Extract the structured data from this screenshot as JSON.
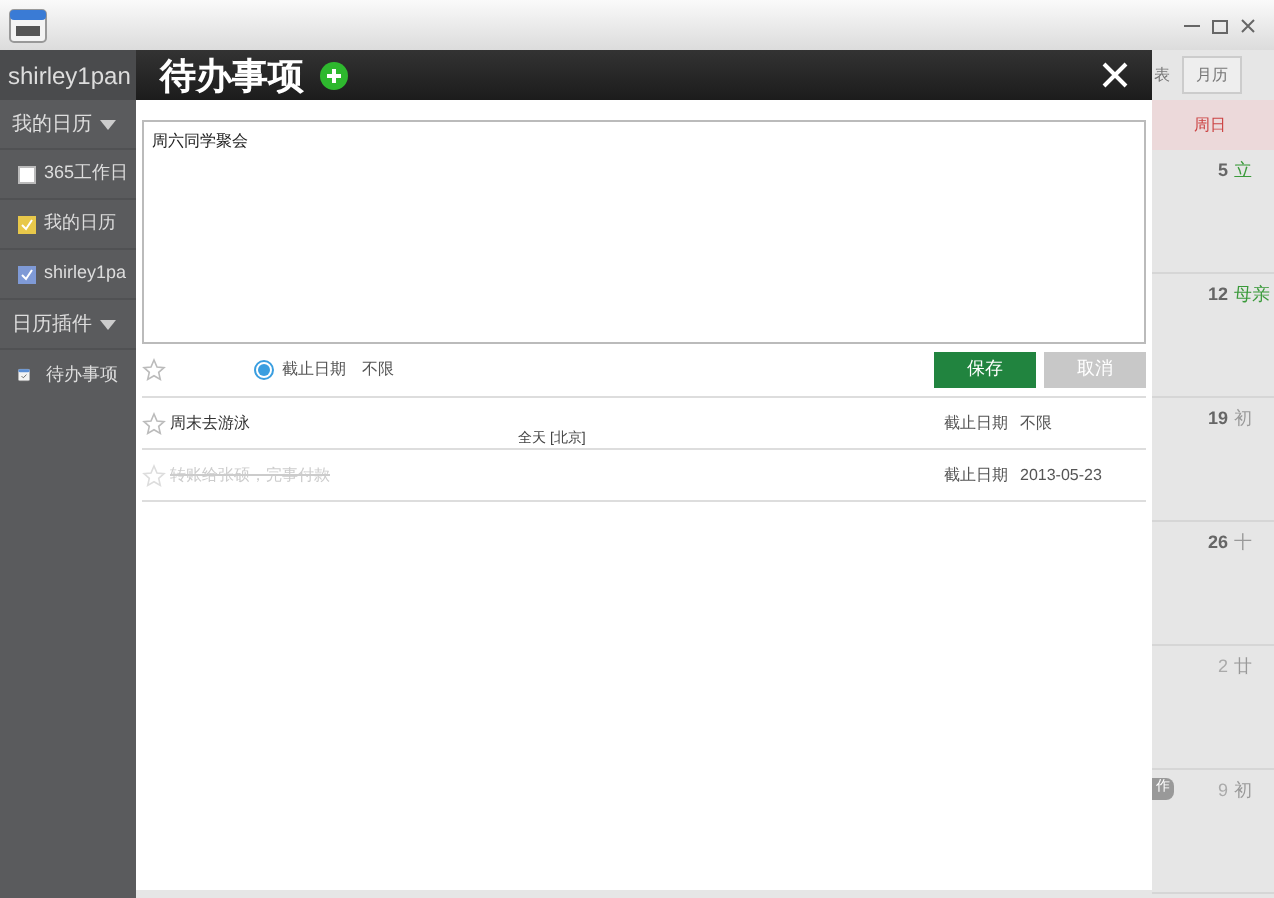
{
  "sidebar": {
    "user": "shirley1pan",
    "sections": [
      {
        "title": "我的日历",
        "items": [
          {
            "label": "365工作日",
            "checked": false,
            "color": "#ffffff"
          },
          {
            "label": "我的日历",
            "checked": true,
            "color": "#e8c84a"
          },
          {
            "label": "shirley1pa",
            "checked": true,
            "color": "#7f9ad6"
          }
        ]
      },
      {
        "title": "日历插件"
      }
    ],
    "plugin": {
      "label": "待办事项"
    }
  },
  "calendar": {
    "view_tab_partial": "表",
    "view_tab": "月历",
    "weekday": "周日",
    "badge": "作",
    "days": [
      {
        "day": "5",
        "note": "立",
        "holiday": true,
        "other_month": false
      },
      {
        "day": "12",
        "note": "母亲",
        "holiday": true,
        "other_month": false
      },
      {
        "day": "19",
        "note": "初",
        "holiday": false,
        "other_month": false
      },
      {
        "day": "26",
        "note": "十",
        "holiday": false,
        "other_month": false
      },
      {
        "day": "2",
        "note": "廿",
        "holiday": false,
        "other_month": true
      },
      {
        "day": "9",
        "note": "初",
        "holiday": false,
        "other_month": true
      }
    ]
  },
  "dialog": {
    "title": "待办事项",
    "input": {
      "value": "周六同学聚会"
    },
    "deadline": {
      "label": "截止日期",
      "value": "不限",
      "selected": true
    },
    "save": "保存",
    "cancel": "取消",
    "cancel_disabled": true,
    "overlay_text": "全天 [北京]",
    "todos": [
      {
        "text": "周末去游泳",
        "done": false,
        "deadline_label": "截止日期",
        "deadline": "不限"
      },
      {
        "text": "转账给张硕，完事付款",
        "done": true,
        "deadline_label": "截止日期",
        "deadline": "2013-05-23"
      }
    ]
  }
}
